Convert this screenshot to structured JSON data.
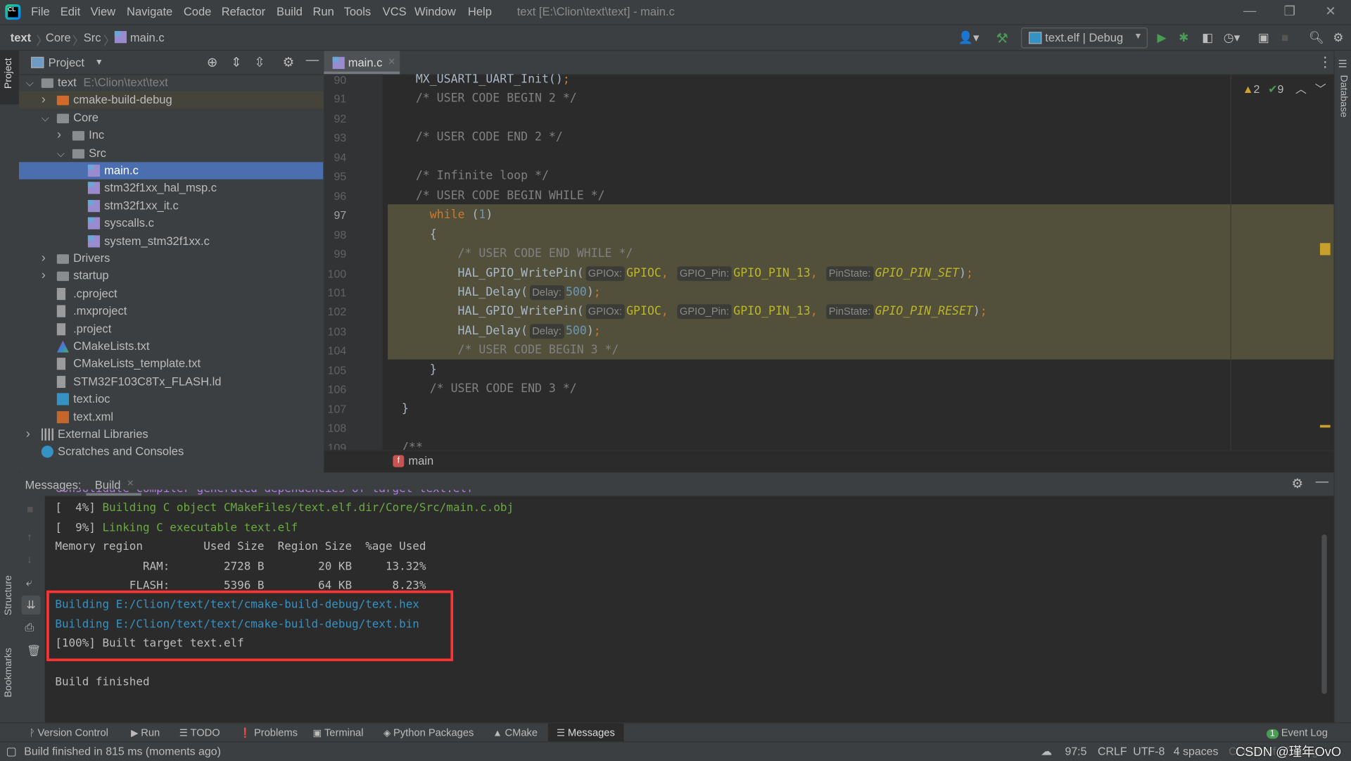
{
  "menubar": {
    "items": [
      "File",
      "Edit",
      "View",
      "Navigate",
      "Code",
      "Refactor",
      "Build",
      "Run",
      "Tools",
      "VCS",
      "Window",
      "Help"
    ],
    "window_title": "text [E:\\Clion\\text\\text] - main.c"
  },
  "navbar": {
    "breadcrumb": [
      "text",
      "Core",
      "Src",
      "main.c"
    ],
    "run_config": "text.elf | Debug"
  },
  "left_strip": {
    "project": "Project",
    "structure": "Structure",
    "bookmarks": "Bookmarks"
  },
  "right_strip": {
    "database": "Database"
  },
  "project": {
    "title": "Project",
    "tree": [
      {
        "label": "text",
        "hint": "E:\\Clion\\text\\text",
        "depth": 0,
        "chevron": "down",
        "icon": "folder"
      },
      {
        "label": "cmake-build-debug",
        "depth": 1,
        "chevron": "right",
        "icon": "folder-orange",
        "state": "excluded"
      },
      {
        "label": "Core",
        "depth": 1,
        "chevron": "down",
        "icon": "folder"
      },
      {
        "label": "Inc",
        "depth": 2,
        "chevron": "right",
        "icon": "folder"
      },
      {
        "label": "Src",
        "depth": 2,
        "chevron": "down",
        "icon": "folder"
      },
      {
        "label": "main.c",
        "depth": 3,
        "icon": "c-file",
        "state": "selected"
      },
      {
        "label": "stm32f1xx_hal_msp.c",
        "depth": 3,
        "icon": "c-file"
      },
      {
        "label": "stm32f1xx_it.c",
        "depth": 3,
        "icon": "c-file"
      },
      {
        "label": "syscalls.c",
        "depth": 3,
        "icon": "c-file"
      },
      {
        "label": "system_stm32f1xx.c",
        "depth": 3,
        "icon": "c-file"
      },
      {
        "label": "Drivers",
        "depth": 1,
        "chevron": "right",
        "icon": "folder"
      },
      {
        "label": "startup",
        "depth": 1,
        "chevron": "right",
        "icon": "folder"
      },
      {
        "label": ".cproject",
        "depth": 1,
        "icon": "text-file"
      },
      {
        "label": ".mxproject",
        "depth": 1,
        "icon": "text-file"
      },
      {
        "label": ".project",
        "depth": 1,
        "icon": "text-file"
      },
      {
        "label": "CMakeLists.txt",
        "depth": 1,
        "icon": "cmake-file"
      },
      {
        "label": "CMakeLists_template.txt",
        "depth": 1,
        "icon": "text-file"
      },
      {
        "label": "STM32F103C8Tx_FLASH.ld",
        "depth": 1,
        "icon": "text-file"
      },
      {
        "label": "text.ioc",
        "depth": 1,
        "icon": "ioc-file"
      },
      {
        "label": "text.xml",
        "depth": 1,
        "icon": "xml-file"
      },
      {
        "label": "External Libraries",
        "depth": 0,
        "chevron": "right",
        "icon": "libraries"
      },
      {
        "label": "Scratches and Consoles",
        "depth": 0,
        "icon": "scratches"
      }
    ]
  },
  "editor": {
    "tab": "main.c",
    "warnings": "2",
    "weak_warnings": "9",
    "current_line": 97,
    "breadcrumb_fn": "main",
    "lines": [
      {
        "n": "90",
        "tokens": [
          [
            "p",
            "    MX_USART1_UART_Init()"
          ],
          [
            "sc",
            ";"
          ]
        ]
      },
      {
        "n": "91",
        "tokens": [
          [
            "cm",
            "    /* USER CODE BEGIN 2 */"
          ]
        ]
      },
      {
        "n": "92",
        "tokens": []
      },
      {
        "n": "93",
        "tokens": [
          [
            "cm",
            "    /* USER CODE END 2 */"
          ]
        ]
      },
      {
        "n": "94",
        "tokens": []
      },
      {
        "n": "95",
        "tokens": [
          [
            "cm",
            "    /* Infinite loop */"
          ]
        ]
      },
      {
        "n": "96",
        "tokens": [
          [
            "cm",
            "    /* USER CODE BEGIN WHILE */"
          ]
        ]
      },
      {
        "n": "97",
        "tokens": [
          [
            "p",
            "      "
          ],
          [
            "k",
            "while"
          ],
          [
            "p",
            " ("
          ],
          [
            "n",
            "1"
          ],
          [
            "p",
            ")"
          ]
        ]
      },
      {
        "n": "98",
        "tokens": [
          [
            "p",
            "      {"
          ]
        ]
      },
      {
        "n": "99",
        "tokens": [
          [
            "cm",
            "          /* USER CODE END WHILE */"
          ]
        ]
      },
      {
        "n": "100",
        "tokens": [
          [
            "p",
            "          HAL_GPIO_WritePin("
          ],
          [
            "ph",
            "GPIOx:"
          ],
          [
            "m",
            "GPIOC"
          ],
          [
            "sc",
            ", "
          ],
          [
            "ph",
            "GPIO_Pin:"
          ],
          [
            "m",
            "GPIO_PIN_13"
          ],
          [
            "sc",
            ", "
          ],
          [
            "ph",
            "PinState:"
          ],
          [
            "mi",
            "GPIO_PIN_SET"
          ],
          [
            "p",
            ")"
          ],
          [
            "sc",
            ";"
          ]
        ]
      },
      {
        "n": "101",
        "tokens": [
          [
            "p",
            "          HAL_Delay("
          ],
          [
            "ph",
            "Delay:"
          ],
          [
            "n",
            "500"
          ],
          [
            "p",
            ")"
          ],
          [
            "sc",
            ";"
          ]
        ]
      },
      {
        "n": "102",
        "tokens": [
          [
            "p",
            "          HAL_GPIO_WritePin("
          ],
          [
            "ph",
            "GPIOx:"
          ],
          [
            "m",
            "GPIOC"
          ],
          [
            "sc",
            ", "
          ],
          [
            "ph",
            "GPIO_Pin:"
          ],
          [
            "m",
            "GPIO_PIN_13"
          ],
          [
            "sc",
            ", "
          ],
          [
            "ph",
            "PinState:"
          ],
          [
            "mi",
            "GPIO_PIN_RESET"
          ],
          [
            "p",
            ")"
          ],
          [
            "sc",
            ";"
          ]
        ]
      },
      {
        "n": "103",
        "tokens": [
          [
            "p",
            "          HAL_Delay("
          ],
          [
            "ph",
            "Delay:"
          ],
          [
            "n",
            "500"
          ],
          [
            "p",
            ")"
          ],
          [
            "sc",
            ";"
          ]
        ]
      },
      {
        "n": "104",
        "tokens": [
          [
            "cm",
            "          /* USER CODE BEGIN 3 */"
          ]
        ]
      },
      {
        "n": "105",
        "tokens": [
          [
            "p",
            "      }"
          ]
        ]
      },
      {
        "n": "106",
        "tokens": [
          [
            "cm",
            "      /* USER CODE END 3 */"
          ]
        ]
      },
      {
        "n": "107",
        "tokens": [
          [
            "p",
            "  }"
          ]
        ]
      },
      {
        "n": "108",
        "tokens": []
      },
      {
        "n": "109",
        "tokens": [
          [
            "cm",
            "  /**"
          ]
        ]
      }
    ]
  },
  "messages": {
    "label": "Messages:",
    "tab": "Build",
    "output": [
      {
        "style": "purple",
        "text": "Consolidate compiler generated dependencies of target text.elf"
      },
      {
        "style": "green",
        "prefix": "[  4%] ",
        "text": "Building C object CMakeFiles/text.elf.dir/Core/Src/main.c.obj"
      },
      {
        "style": "green",
        "prefix": "[  9%] ",
        "text": "Linking C executable text.elf"
      },
      {
        "style": "plain",
        "text": "Memory region         Used Size  Region Size  %age Used"
      },
      {
        "style": "plain",
        "text": "             RAM:        2728 B        20 KB     13.32%"
      },
      {
        "style": "plain",
        "text": "           FLASH:        5396 B        64 KB      8.23%"
      },
      {
        "style": "blue",
        "text": "Building E:/Clion/text/text/cmake-build-debug/text.hex"
      },
      {
        "style": "blue",
        "text": "Building E:/Clion/text/text/cmake-build-debug/text.bin"
      },
      {
        "style": "plain",
        "text": "[100%] Built target text.elf"
      },
      {
        "style": "plain",
        "text": ""
      },
      {
        "style": "plain",
        "text": "Build finished"
      }
    ],
    "highlight_color": "#ff3333"
  },
  "tool_windows": [
    "Version Control",
    "Run",
    "TODO",
    "Problems",
    "Terminal",
    "Python Packages",
    "CMake",
    "Messages"
  ],
  "tool_windows_active": "Messages",
  "event_log": {
    "count": "1",
    "label": "Event Log"
  },
  "statusbar": {
    "message": "Build finished in 815 ms (moments ago)",
    "position": "97:5",
    "line_sep": "CRLF",
    "encoding": "UTF-8",
    "indent": "4 spaces",
    "context": "C: text.elf | Debug",
    "watermark": "CSDN @瑾年OvO"
  }
}
